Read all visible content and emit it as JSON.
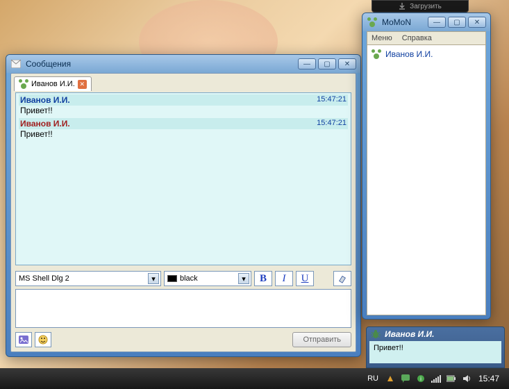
{
  "download_bar": {
    "label": "Загрузить"
  },
  "msg_window": {
    "title": "Сообщения",
    "tab": {
      "label": "Иванов И.И."
    },
    "chat": [
      {
        "kind": "header-remote",
        "sender": "Иванов И.И.",
        "time": "15:47:21"
      },
      {
        "kind": "body",
        "text": "Привет!!"
      },
      {
        "kind": "header-local",
        "sender": "Иванов И.И.",
        "time": "15:47:21"
      },
      {
        "kind": "body",
        "text": "Привет!!"
      }
    ],
    "font_combo": "MS Shell Dlg 2",
    "color_combo": "black",
    "fmt": {
      "bold": "B",
      "italic": "I",
      "underline": "U"
    },
    "send_label": "Отправить",
    "input_value": ""
  },
  "contact_window": {
    "title": "MoMoN",
    "menu": {
      "menu": "Меню",
      "help": "Справка"
    },
    "contacts": [
      {
        "name": "Иванов И.И."
      }
    ]
  },
  "toast": {
    "sender": "Иванов И.И.",
    "text": "Привет!!"
  },
  "taskbar": {
    "lang": "RU",
    "clock": "15:47"
  }
}
